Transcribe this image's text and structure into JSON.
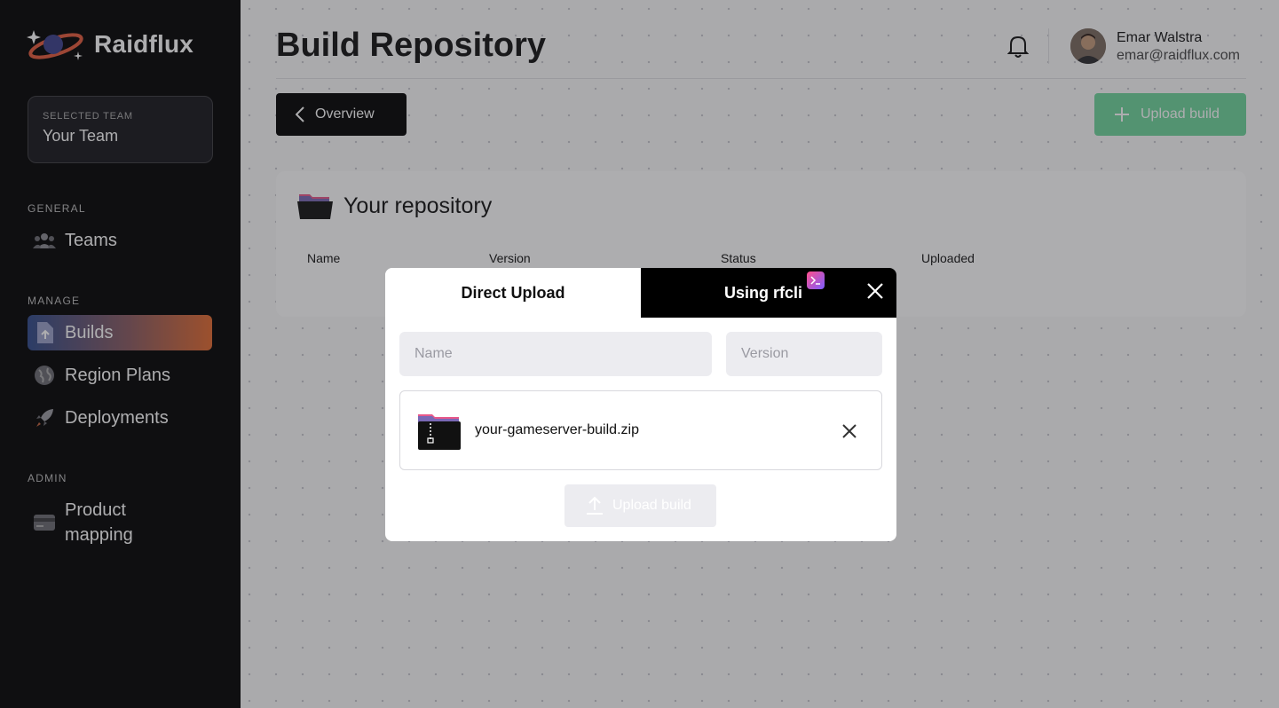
{
  "sidebar": {
    "brand": "Raidflux",
    "team_caption": "SELECTED TEAM",
    "team_name": "Your Team",
    "sections": {
      "general": "GENERAL",
      "manage": "MANAGE",
      "admin": "ADMIN"
    },
    "items": {
      "teams": "Teams",
      "builds": "Builds",
      "region_plans": "Region Plans",
      "deployments": "Deployments",
      "product_mapping": "Product mapping"
    }
  },
  "header": {
    "title": "Build Repository",
    "user_name": "Emar Walstra",
    "user_email": "emar@raidflux.com"
  },
  "toolbar": {
    "overview_label": "Overview",
    "upload_label": "Upload build"
  },
  "repository": {
    "title": "Your repository",
    "columns": [
      "Name",
      "Version",
      "Status",
      "Uploaded"
    ]
  },
  "modal": {
    "tab_direct": "Direct Upload",
    "tab_cli": "Using rfcli",
    "name_placeholder": "Name",
    "version_placeholder": "Version",
    "file_name": "your-gameserver-build.zip",
    "upload_label": "Upload build"
  },
  "colors": {
    "accent_green": "#6fd69b",
    "active_gradient_start": "#2f4a8a",
    "active_gradient_end": "#e46a2e"
  }
}
